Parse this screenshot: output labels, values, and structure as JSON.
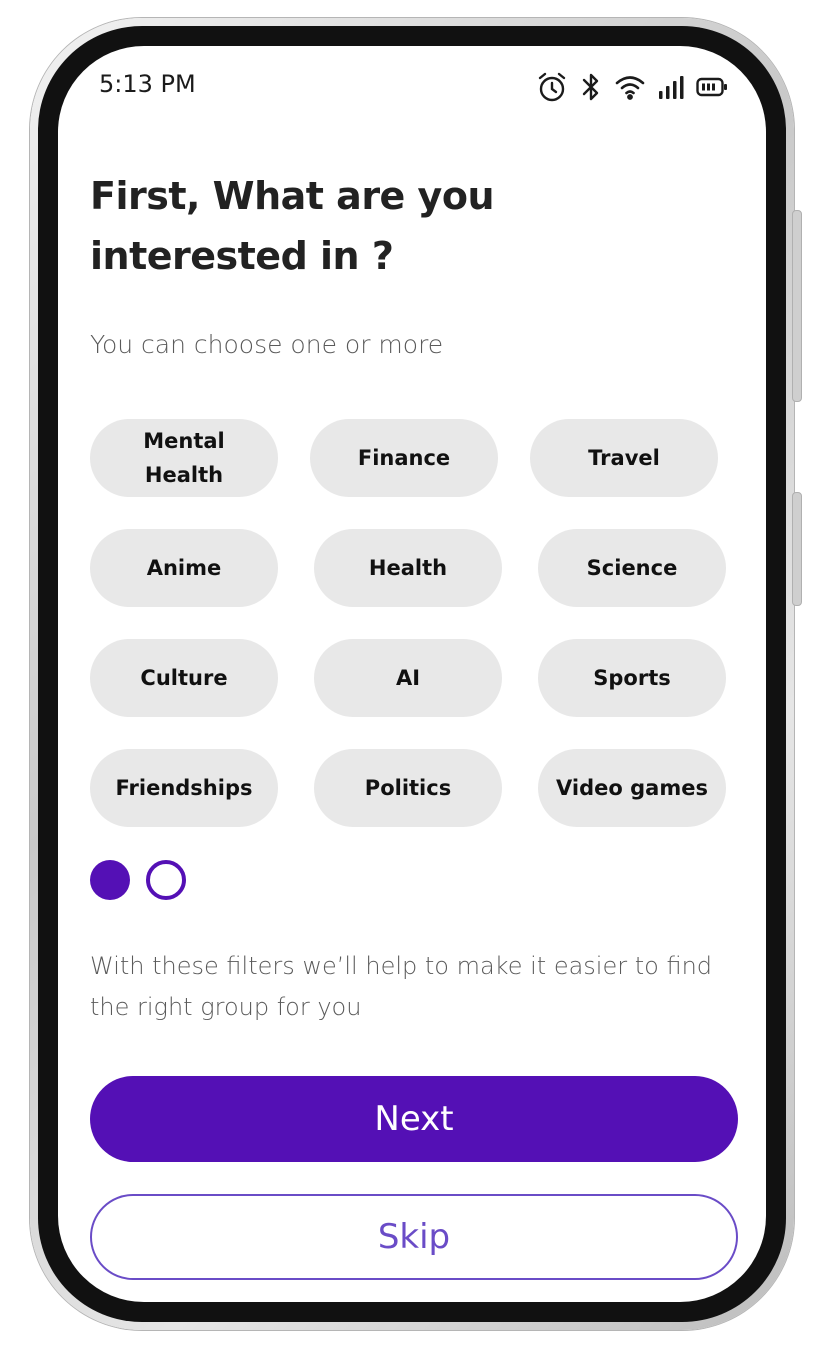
{
  "status_bar": {
    "time": "5:13 PM",
    "icons": [
      "alarm-icon",
      "bluetooth-icon",
      "wifi-icon",
      "signal-icon",
      "battery-icon"
    ]
  },
  "title": "First, What are you interested in ?",
  "subtitle": "You can choose one or more",
  "interests": [
    "Mental Health",
    "Finance",
    "Travel",
    "Anime",
    "Health",
    "Science",
    "Culture",
    "AI",
    "Sports",
    "Friendships",
    "Politics",
    "Video games"
  ],
  "pagination": {
    "current": 1,
    "total": 2
  },
  "helper_text": "With these filters we’ll help to make it easier to find the right group for you",
  "buttons": {
    "next": "Next",
    "skip": "Skip"
  },
  "colors": {
    "primary": "#5410b5",
    "skip_outline": "#6a4cc7",
    "chip_bg": "#e8e8e8"
  }
}
